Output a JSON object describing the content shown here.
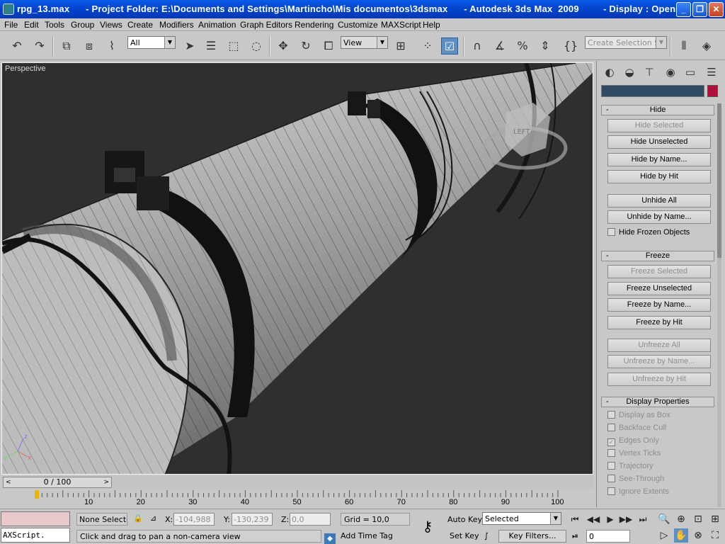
{
  "window": {
    "title": "rpg_13.max      - Project Folder: E:\\Documents and Settings\\Martincho\\Mis documentos\\3dsmax      - Autodesk 3ds Max  2009         - Display : OpenGL",
    "minimize": "_",
    "maximize": "❐",
    "close": "✕"
  },
  "menu": [
    "File",
    "Edit",
    "Tools",
    "Group",
    "Views",
    "Create",
    "Modifiers",
    "Animation",
    "Graph Editors",
    "Rendering",
    "Customize",
    "MAXScript",
    "Help"
  ],
  "toolbar": {
    "selection_filter": "All",
    "reference_coord": "View",
    "named_selection_placeholder": "Create Selection Set",
    "icons": [
      "undo-icon",
      "redo-icon",
      "select-link-icon",
      "unlink-icon",
      "bind-space-warp-icon",
      "select-object-icon",
      "select-by-name-icon",
      "rect-selection-icon",
      "window-crossing-icon",
      "move-icon",
      "rotate-icon",
      "scale-icon",
      "pivot-center-icon",
      "select-manipulate-icon",
      "keyboard-shortcut-toggle-icon",
      "snaps-toggle-icon",
      "angle-snap-icon",
      "percent-snap-icon",
      "spinner-snap-icon",
      "edit-named-sel-icon",
      "mirror-icon",
      "align-icon"
    ]
  },
  "viewport": {
    "label": "Perspective",
    "background": "#2f2f2f",
    "viewcube_face": "LEFT"
  },
  "command_panel": {
    "tabs": [
      "create-tab",
      "modify-tab",
      "hierarchy-tab",
      "motion-tab",
      "display-tab",
      "utilities-tab"
    ],
    "object_color": "#b0103c",
    "hide": {
      "title": "Hide",
      "buttons": [
        {
          "label": "Hide Selected",
          "enabled": false
        },
        {
          "label": "Hide Unselected",
          "enabled": true
        },
        {
          "label": "Hide by Name...",
          "enabled": true
        },
        {
          "label": "Hide by Hit",
          "enabled": true
        },
        {
          "label": "Unhide All",
          "enabled": true
        },
        {
          "label": "Unhide by Name...",
          "enabled": true
        }
      ],
      "hide_frozen": "Hide Frozen Objects"
    },
    "freeze": {
      "title": "Freeze",
      "buttons": [
        {
          "label": "Freeze Selected",
          "enabled": false
        },
        {
          "label": "Freeze Unselected",
          "enabled": true
        },
        {
          "label": "Freeze by Name...",
          "enabled": true
        },
        {
          "label": "Freeze by Hit",
          "enabled": true
        },
        {
          "label": "Unfreeze All",
          "enabled": false
        },
        {
          "label": "Unfreeze by Name...",
          "enabled": false
        },
        {
          "label": "Unfreeze by Hit",
          "enabled": false
        }
      ]
    },
    "display_properties": {
      "title": "Display Properties",
      "items": [
        {
          "label": "Display as Box",
          "checked": false
        },
        {
          "label": "Backface Cull",
          "checked": false
        },
        {
          "label": "Edges Only",
          "checked": true
        },
        {
          "label": "Vertex Ticks",
          "checked": false
        },
        {
          "label": "Trajectory",
          "checked": false
        },
        {
          "label": "See-Through",
          "checked": false
        },
        {
          "label": "Ignore Extents",
          "checked": false
        }
      ]
    }
  },
  "timeline": {
    "slider": "0 / 100",
    "prev": "<",
    "next": ">",
    "ticks": [
      "10",
      "20",
      "30",
      "40",
      "50",
      "60",
      "70",
      "80",
      "90",
      "100"
    ]
  },
  "status": {
    "maxscript": "AXScript.",
    "selection": "None Selecte",
    "x_label": "X:",
    "x": "-104,988",
    "y_label": "Y:",
    "y": "-130,239",
    "z_label": "Z:",
    "z": "0,0",
    "grid": "Grid = 10,0",
    "prompt": "Click and drag to pan a non-camera view",
    "add_time_tag": "Add Time Tag",
    "auto_key": "Auto Key",
    "set_key": "Set Key",
    "key_mode": "Selected",
    "key_filters": "Key Filters...",
    "frame": "0"
  }
}
